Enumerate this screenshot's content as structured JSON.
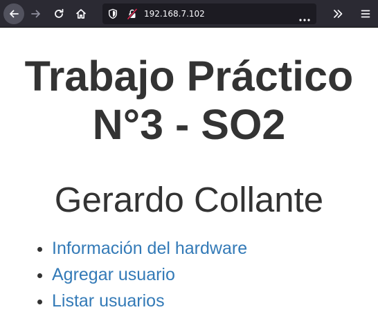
{
  "browser": {
    "url": "192.168.7.102",
    "icons": {
      "back": "arrow-left-icon",
      "forward": "arrow-right-icon",
      "reload": "reload-icon",
      "home": "home-icon",
      "tracking": "shield-icon",
      "insecure": "insecure-lock-icon",
      "page_actions": "more-horizontal-icon",
      "overflow": "chevron-double-right-icon",
      "menu": "hamburger-menu-icon"
    },
    "colors": {
      "toolbar": "#2b2a33",
      "urlbar": "#1c1b22",
      "insecure": "#e22850"
    }
  },
  "page": {
    "title_line1": "Trabajo Práctico",
    "title_line2": "N°3 - SO2",
    "subtitle": "Gerardo Collante",
    "links": [
      {
        "label": "Información del hardware"
      },
      {
        "label": "Agregar usuario"
      },
      {
        "label": "Listar usuarios"
      }
    ],
    "colors": {
      "text": "#333333",
      "link": "#337ab7"
    }
  }
}
